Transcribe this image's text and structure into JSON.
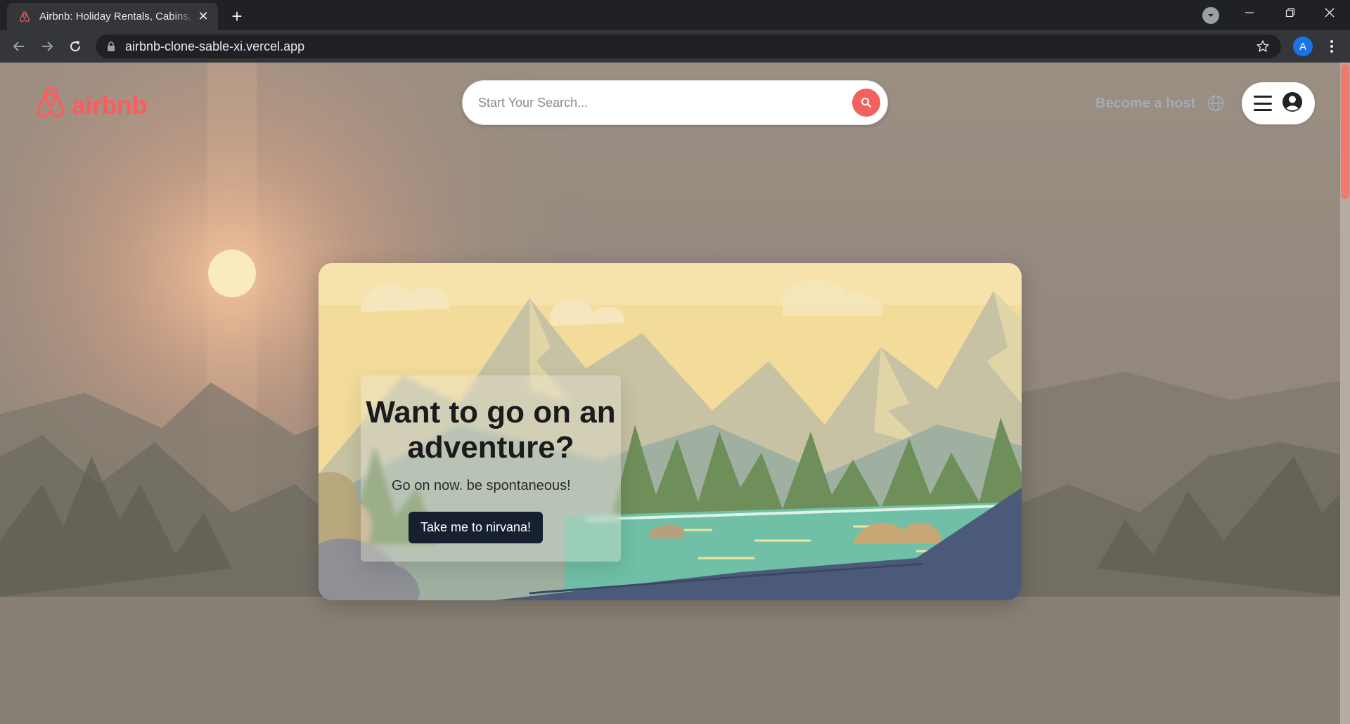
{
  "browser": {
    "tab_title": "Airbnb: Holiday Rentals, Cabins, Beach Houses",
    "url": "airbnb-clone-sable-xi.vercel.app",
    "profile_initial": "A",
    "new_tab_label": "+",
    "close_label": "✕"
  },
  "header": {
    "logo_text": "airbnb",
    "search_placeholder": "Start Your Search...",
    "become_host": "Become a host"
  },
  "hero": {
    "title": "Want to go on an adventure?",
    "subtitle": "Go on now. be spontaneous!",
    "cta_label": "Take me to nirvana!"
  },
  "colors": {
    "brand": "#ff5a5f",
    "cta": "#17202e",
    "search_button": "#f0615f"
  }
}
